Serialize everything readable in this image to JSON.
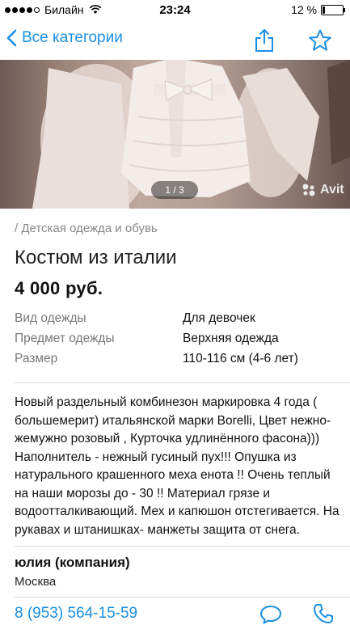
{
  "status_bar": {
    "carrier": "Билайн",
    "time": "23:24",
    "battery": "12 %",
    "battery_level": 0.12
  },
  "nav": {
    "back_label": "Все категории",
    "share_icon": "share-icon",
    "favorite_icon": "star-icon",
    "accent_color": "#1a8fe3"
  },
  "photo": {
    "counter": "1 / 3",
    "watermark": "Avit"
  },
  "listing": {
    "category": "/ Детская одежда и обувь",
    "title": "Костюм из италии",
    "price": "4 000 руб.",
    "params": [
      {
        "label": "Вид одежды",
        "value": "Для девочек"
      },
      {
        "label": "Предмет одежды",
        "value": "Верхняя одежда"
      },
      {
        "label": "Размер",
        "value": "110-116 см (4-6 лет)"
      }
    ],
    "description": "Новый раздельный комбинезон маркировка 4 года ( большемерит) итальянской марки Borelli, Цвет нежно-жемужно розовый , Курточка удлинённого фасона))) Наполнитель - нежный гусиный пух!!! Опушка из натурального крашенного меха енота !! Очень теплый на наши морозы до - 30 !! Материал грязе и водоотталкивающий. Мех и капюшон отстегивается. На рукавах и штанишках- манжеты защита от снега."
  },
  "seller": {
    "name": "юлия (компания)",
    "city": "Москва",
    "phone": "8 (953) 564-15-59"
  }
}
